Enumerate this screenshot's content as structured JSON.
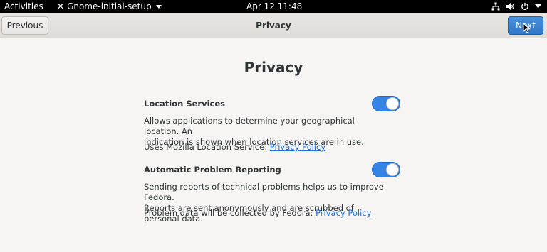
{
  "topbar": {
    "activities": "Activities",
    "app_name": "Gnome-initial-setup",
    "clock": "Apr 12  11:48",
    "icons": [
      "network-icon",
      "volume-icon",
      "power-icon",
      "chevron-down-icon"
    ]
  },
  "headerbar": {
    "prev_label": "Previous",
    "title": "Privacy",
    "next_label": "Next"
  },
  "page": {
    "title": "Privacy",
    "location": {
      "title": "Location Services",
      "desc_line1": "Allows applications to determine your geographical location. An",
      "desc_line2": "indication is shown when location services are in use.",
      "policy_prefix": "Uses Mozilla Location Service: ",
      "policy_link": "Privacy Policy",
      "enabled": true
    },
    "reporting": {
      "title": "Automatic Problem Reporting",
      "desc_line1": "Sending reports of technical problems helps us to improve Fedora.",
      "desc_line2": "Reports are sent anonymously and are scrubbed of personal data.",
      "policy_prefix": "Problem data will be collected by Fedora: ",
      "policy_link": "Privacy Policy",
      "enabled": true
    }
  },
  "colors": {
    "accent": "#3584e4",
    "link": "#1c71d8",
    "topbar": "#000000",
    "background": "#f6f5f4"
  }
}
